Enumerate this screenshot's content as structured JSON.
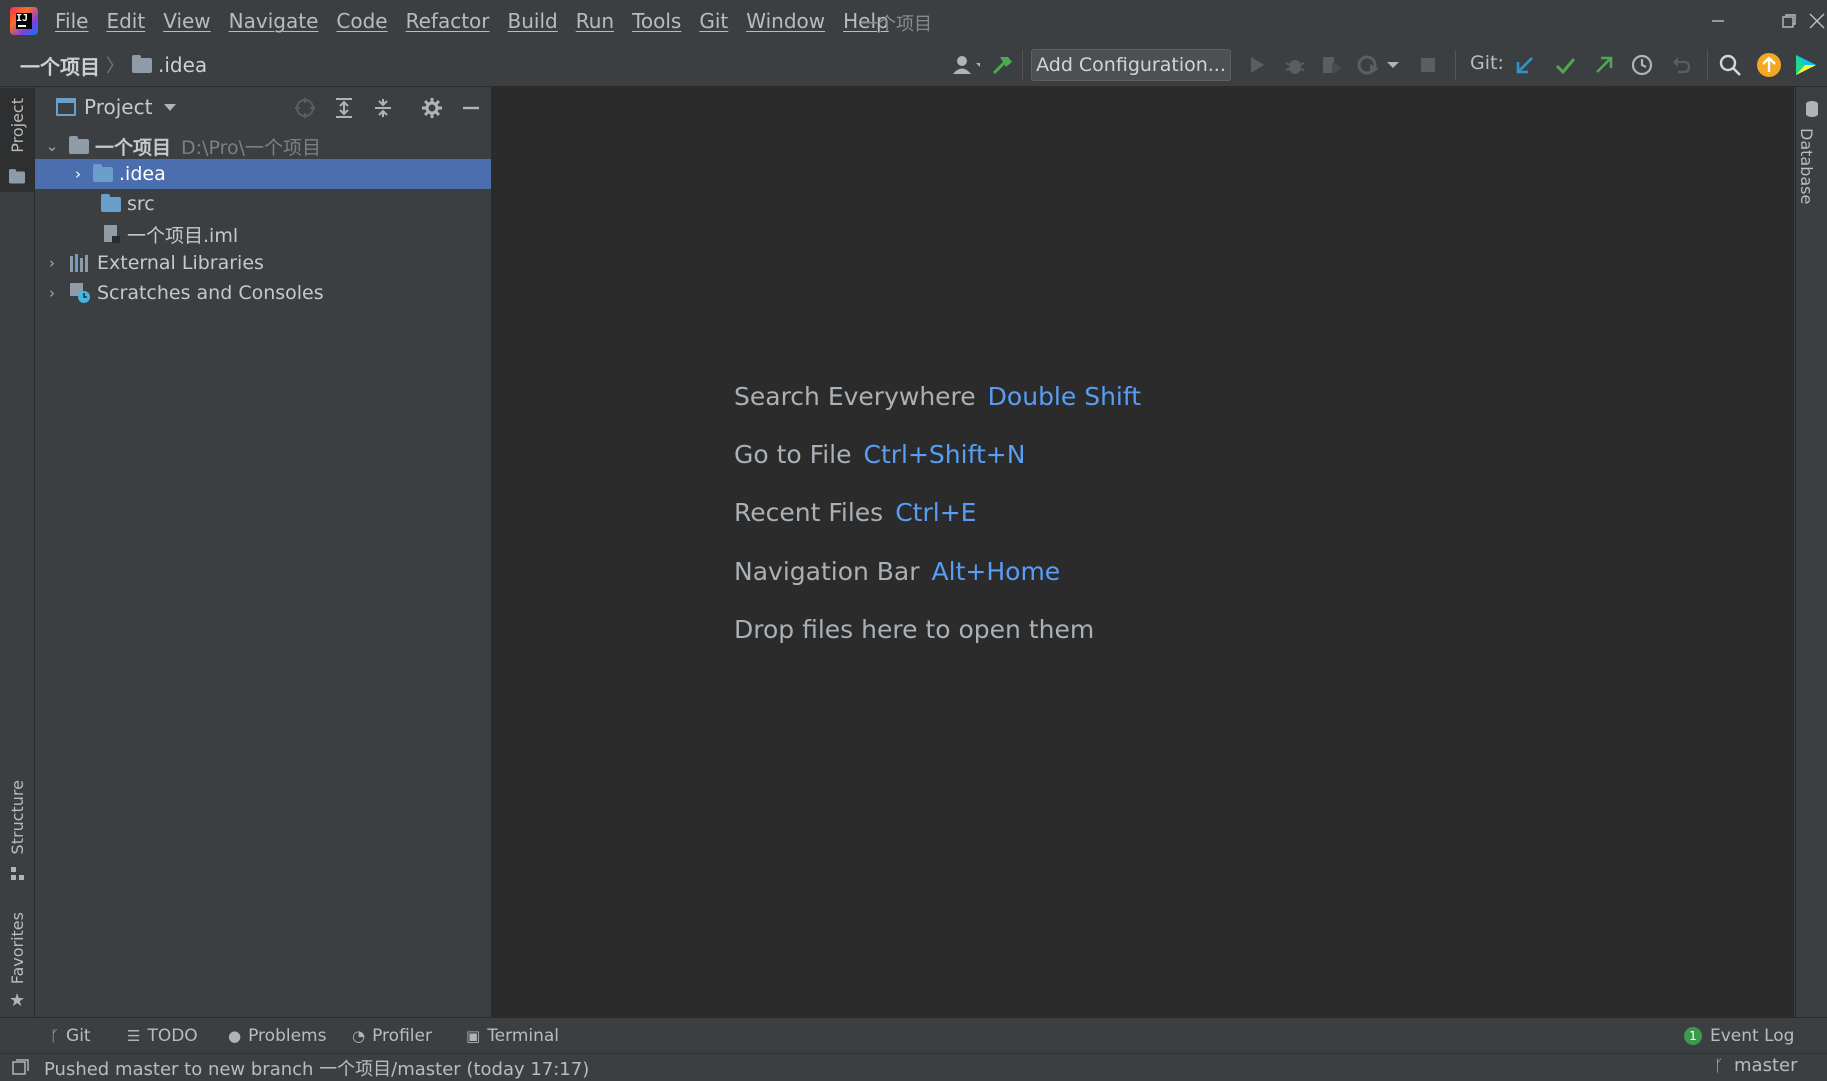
{
  "window": {
    "title": "一个项目",
    "menu": [
      "File",
      "Edit",
      "View",
      "Navigate",
      "Code",
      "Refactor",
      "Build",
      "Run",
      "Tools",
      "Git",
      "Window",
      "Help"
    ]
  },
  "navbar": {
    "breadcrumb": [
      "一个项目",
      ".idea"
    ],
    "add_configuration": "Add Configuration...",
    "git_label": "Git:",
    "toolbar_icons": [
      "user-icon",
      "hammer-icon",
      "run-icon",
      "debug-icon",
      "coverage-icon",
      "profile-icon",
      "stop-icon",
      "git-update-icon",
      "git-commit-icon",
      "git-push-icon",
      "history-icon",
      "rollback-icon",
      "search-icon",
      "update-available-icon",
      "toolbox-icon"
    ]
  },
  "left_strip": {
    "project": "Project",
    "structure": "Structure",
    "favorites": "Favorites"
  },
  "right_strip": {
    "database": "Database"
  },
  "project_panel": {
    "title": "Project",
    "tree": [
      {
        "label": "一个项目",
        "path": "D:\\Pro\\一个项目",
        "expanded": true
      },
      {
        "label": ".idea",
        "selected": true
      },
      {
        "label": "src"
      },
      {
        "label": "一个项目.iml"
      },
      {
        "label": "External Libraries"
      },
      {
        "label": "Scratches and Consoles"
      }
    ]
  },
  "editor_hints": [
    {
      "text": "Search Everywhere",
      "key": "Double Shift"
    },
    {
      "text": "Go to File",
      "key": "Ctrl+Shift+N"
    },
    {
      "text": "Recent Files",
      "key": "Ctrl+E"
    },
    {
      "text": "Navigation Bar",
      "key": "Alt+Home"
    },
    {
      "text": "Drop files here to open them",
      "key": ""
    }
  ],
  "bottom_tabs": [
    "Git",
    "TODO",
    "Problems",
    "Profiler",
    "Terminal"
  ],
  "event_log": {
    "label": "Event Log",
    "count": "1"
  },
  "status": {
    "message": "Pushed master to new branch 一个项目/master (today 17:17)",
    "branch": "master"
  },
  "colors": {
    "accent_blue": "#589df6",
    "selection": "#4b6eaf",
    "annotation_arrow": "#ff1a1a"
  }
}
